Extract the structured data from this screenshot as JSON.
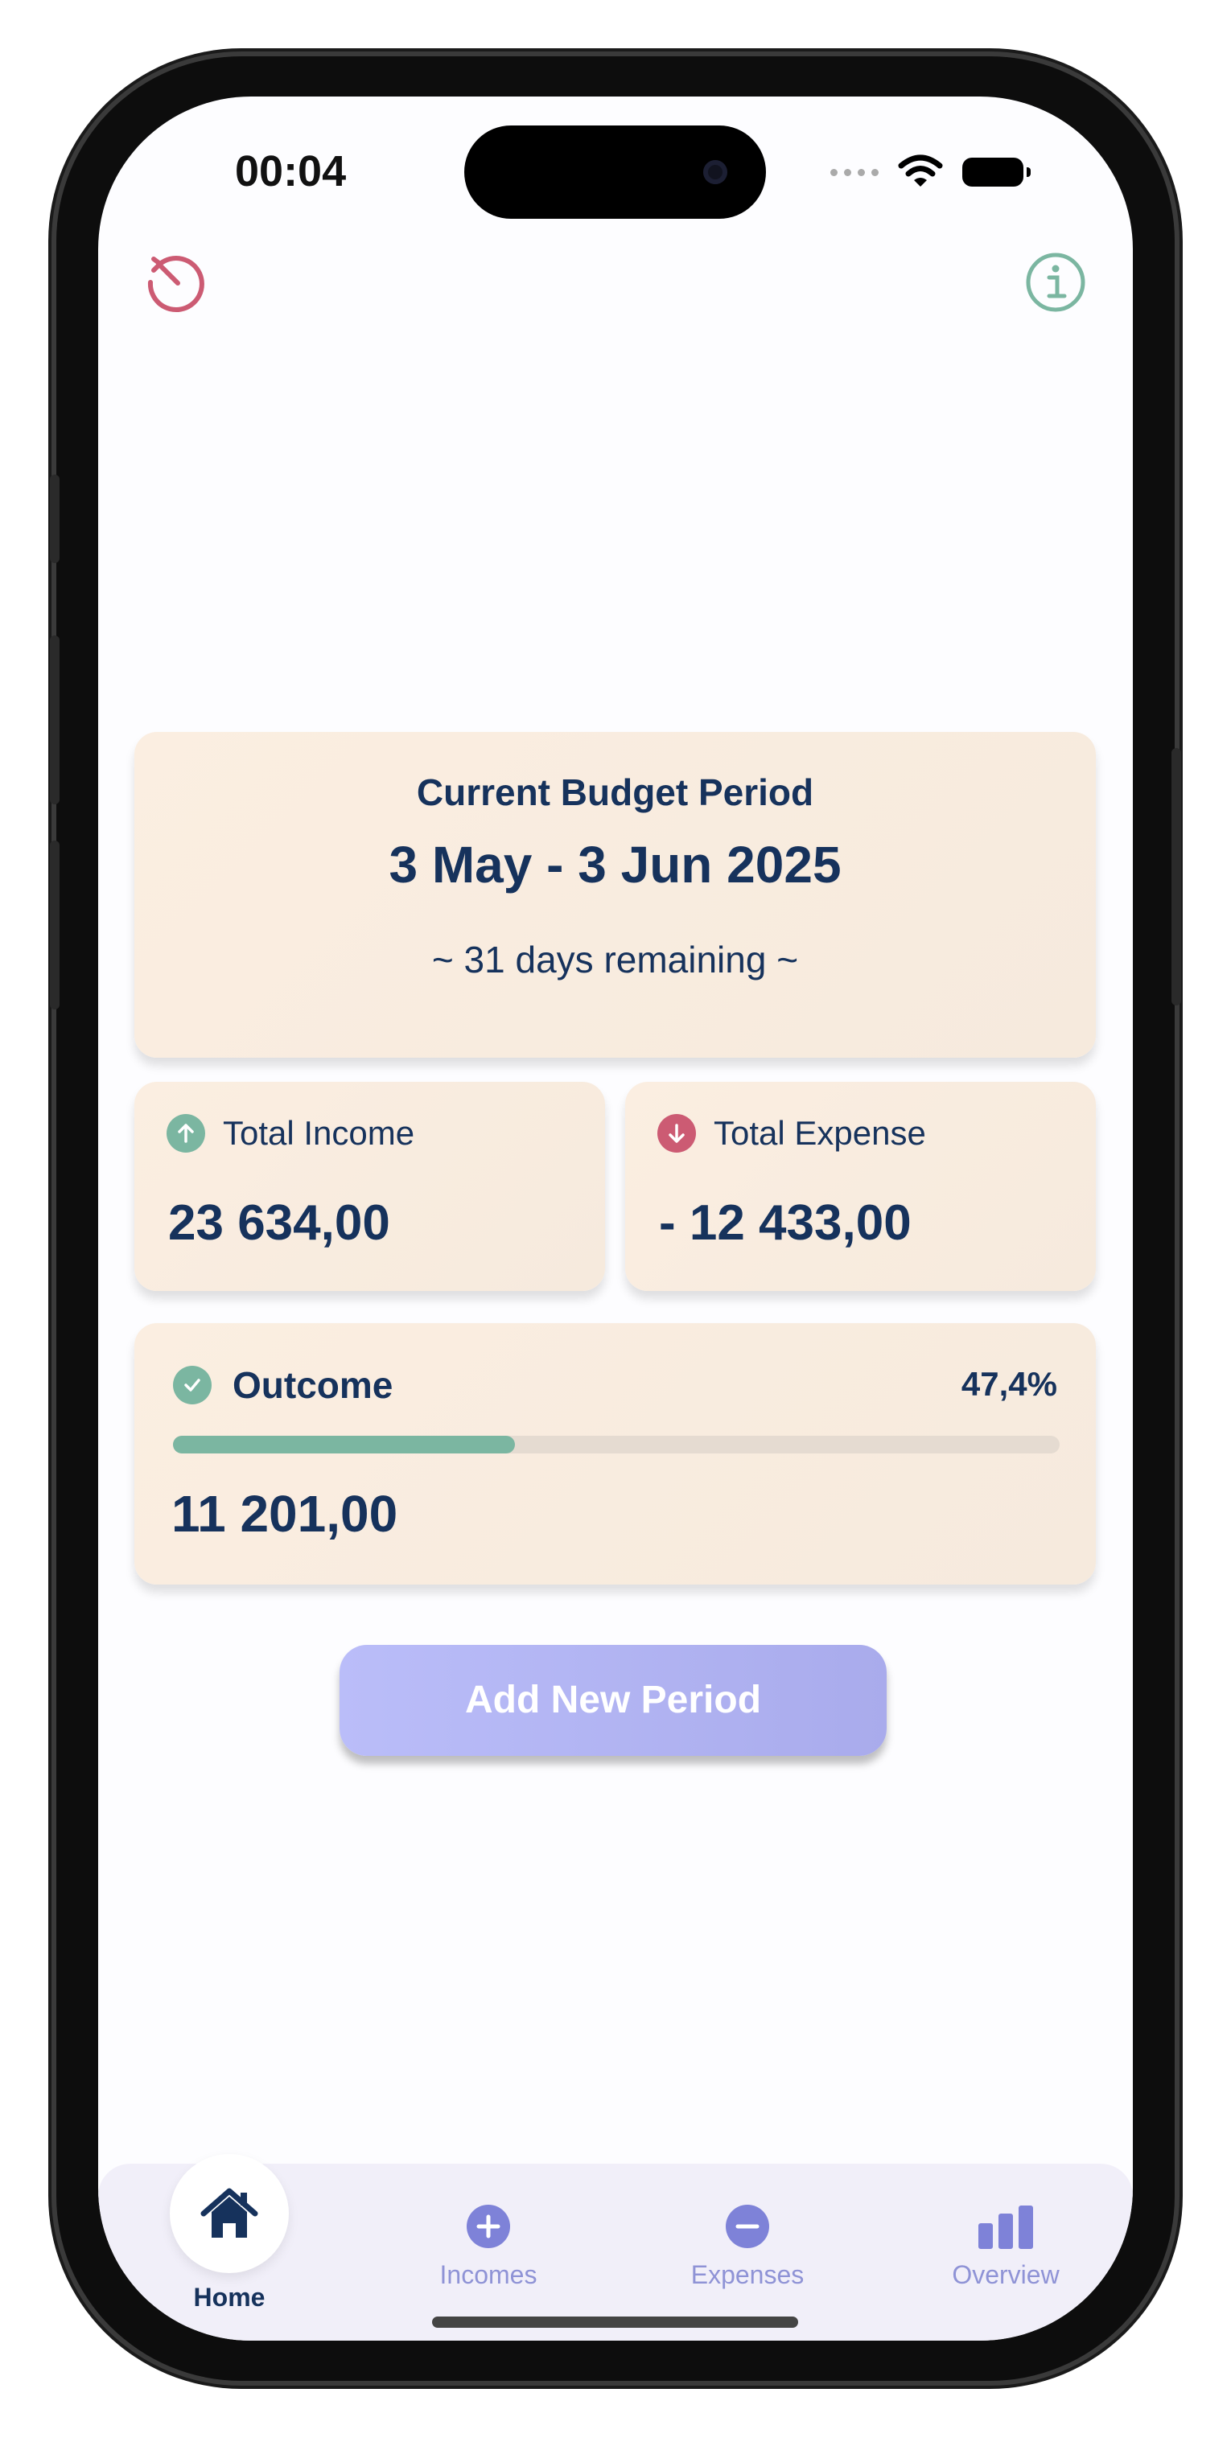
{
  "status_bar": {
    "time": "00:04"
  },
  "period": {
    "title": "Current Budget Period",
    "dates": "3 May - 3 Jun 2025",
    "remaining": "~ 31 days remaining ~"
  },
  "income": {
    "label": "Total Income",
    "value": "23 634,00"
  },
  "expense": {
    "label": "Total Expense",
    "value": "- 12 433,00"
  },
  "outcome": {
    "label": "Outcome",
    "percent": "47,4%",
    "progress_fraction": 0.386,
    "value": "11 201,00"
  },
  "actions": {
    "add_period_label": "Add New Period"
  },
  "tabs": [
    {
      "label": "Home",
      "icon": "house-icon",
      "active": true
    },
    {
      "label": "Incomes",
      "icon": "plus-circle-icon",
      "active": false
    },
    {
      "label": "Expenses",
      "icon": "minus-circle-icon",
      "active": false
    },
    {
      "label": "Overview",
      "icon": "bar-chart-icon",
      "active": false
    }
  ],
  "colors": {
    "primary_text": "#16325c",
    "income_green": "#7bb6a1",
    "expense_red": "#cc5b73",
    "accent_purple": "#8f93d6",
    "card_bg": "#fbeee1"
  }
}
